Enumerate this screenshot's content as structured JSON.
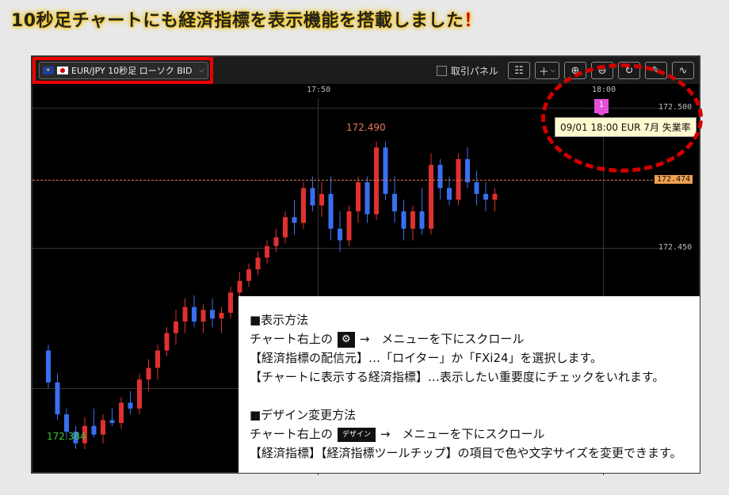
{
  "headline": {
    "text": "10秒足チャートにも経済指標を表示機能を搭載しました",
    "bang": "！"
  },
  "toolbar": {
    "symbol_label": "EUR/JPY 10秒足 ローソク BID",
    "panel_label": "取引パネル",
    "buttons": [
      "indicator-icon",
      "plus-icon",
      "zoom-in-icon",
      "zoom-out-icon",
      "refresh-icon",
      "pen-icon",
      "draw-icon"
    ]
  },
  "chart": {
    "time_labels": [
      "17:50",
      "18:00"
    ],
    "price_labels": [
      "172.500",
      "172.450"
    ],
    "current_price": "172.474",
    "high_label": "172.490",
    "low_label": "172.384",
    "event_marker": "1",
    "event_tooltip": "09/01 18:00 EUR 7月 失業率",
    "colors": {
      "up": "#e03030",
      "down": "#3a6ef0",
      "current": "#f0a050"
    }
  },
  "chart_data": {
    "type": "candlestick",
    "title": "",
    "xlabel": "",
    "ylabel": "",
    "ylim": [
      172.375,
      172.505
    ],
    "candles": [
      {
        "o": 172.418,
        "h": 172.42,
        "l": 172.405,
        "c": 172.407
      },
      {
        "o": 172.407,
        "h": 172.41,
        "l": 172.394,
        "c": 172.396
      },
      {
        "o": 172.396,
        "h": 172.398,
        "l": 172.388,
        "c": 172.39
      },
      {
        "o": 172.39,
        "h": 172.392,
        "l": 172.384,
        "c": 172.386
      },
      {
        "o": 172.386,
        "h": 172.395,
        "l": 172.384,
        "c": 172.392
      },
      {
        "o": 172.392,
        "h": 172.398,
        "l": 172.388,
        "c": 172.389
      },
      {
        "o": 172.389,
        "h": 172.396,
        "l": 172.386,
        "c": 172.394
      },
      {
        "o": 172.394,
        "h": 172.398,
        "l": 172.392,
        "c": 172.393
      },
      {
        "o": 172.393,
        "h": 172.402,
        "l": 172.391,
        "c": 172.4
      },
      {
        "o": 172.4,
        "h": 172.404,
        "l": 172.396,
        "c": 172.398
      },
      {
        "o": 172.398,
        "h": 172.41,
        "l": 172.396,
        "c": 172.408
      },
      {
        "o": 172.408,
        "h": 172.415,
        "l": 172.404,
        "c": 172.412
      },
      {
        "o": 172.412,
        "h": 172.42,
        "l": 172.408,
        "c": 172.418
      },
      {
        "o": 172.418,
        "h": 172.426,
        "l": 172.416,
        "c": 172.424
      },
      {
        "o": 172.424,
        "h": 172.432,
        "l": 172.42,
        "c": 172.428
      },
      {
        "o": 172.428,
        "h": 172.436,
        "l": 172.424,
        "c": 172.433
      },
      {
        "o": 172.433,
        "h": 172.437,
        "l": 172.426,
        "c": 172.428
      },
      {
        "o": 172.428,
        "h": 172.434,
        "l": 172.424,
        "c": 172.432
      },
      {
        "o": 172.432,
        "h": 172.436,
        "l": 172.426,
        "c": 172.429
      },
      {
        "o": 172.429,
        "h": 172.433,
        "l": 172.424,
        "c": 172.431
      },
      {
        "o": 172.431,
        "h": 172.44,
        "l": 172.429,
        "c": 172.438
      },
      {
        "o": 172.438,
        "h": 172.445,
        "l": 172.436,
        "c": 172.442
      },
      {
        "o": 172.442,
        "h": 172.448,
        "l": 172.44,
        "c": 172.446
      },
      {
        "o": 172.446,
        "h": 172.452,
        "l": 172.444,
        "c": 172.45
      },
      {
        "o": 172.45,
        "h": 172.456,
        "l": 172.448,
        "c": 172.454
      },
      {
        "o": 172.454,
        "h": 172.46,
        "l": 172.452,
        "c": 172.457
      },
      {
        "o": 172.457,
        "h": 172.466,
        "l": 172.455,
        "c": 172.464
      },
      {
        "o": 172.464,
        "h": 172.47,
        "l": 172.458,
        "c": 172.462
      },
      {
        "o": 172.462,
        "h": 172.476,
        "l": 172.46,
        "c": 172.474
      },
      {
        "o": 172.474,
        "h": 172.478,
        "l": 172.466,
        "c": 172.468
      },
      {
        "o": 172.468,
        "h": 172.476,
        "l": 172.464,
        "c": 172.472
      },
      {
        "o": 172.472,
        "h": 172.478,
        "l": 172.456,
        "c": 172.46
      },
      {
        "o": 172.46,
        "h": 172.466,
        "l": 172.452,
        "c": 172.456
      },
      {
        "o": 172.456,
        "h": 172.468,
        "l": 172.454,
        "c": 172.466
      },
      {
        "o": 172.466,
        "h": 172.478,
        "l": 172.462,
        "c": 172.476
      },
      {
        "o": 172.476,
        "h": 172.478,
        "l": 172.462,
        "c": 172.465
      },
      {
        "o": 172.465,
        "h": 172.49,
        "l": 172.463,
        "c": 172.488
      },
      {
        "o": 172.488,
        "h": 172.49,
        "l": 172.47,
        "c": 172.472
      },
      {
        "o": 172.472,
        "h": 172.478,
        "l": 172.462,
        "c": 172.466
      },
      {
        "o": 172.466,
        "h": 172.47,
        "l": 172.456,
        "c": 172.46
      },
      {
        "o": 172.46,
        "h": 172.468,
        "l": 172.456,
        "c": 172.466
      },
      {
        "o": 172.466,
        "h": 172.474,
        "l": 172.458,
        "c": 172.46
      },
      {
        "o": 172.46,
        "h": 172.486,
        "l": 172.458,
        "c": 172.482
      },
      {
        "o": 172.482,
        "h": 172.484,
        "l": 172.47,
        "c": 172.474
      },
      {
        "o": 172.474,
        "h": 172.478,
        "l": 172.468,
        "c": 172.47
      },
      {
        "o": 172.47,
        "h": 172.486,
        "l": 172.468,
        "c": 172.484
      },
      {
        "o": 172.484,
        "h": 172.488,
        "l": 172.474,
        "c": 172.476
      },
      {
        "o": 172.476,
        "h": 172.48,
        "l": 172.468,
        "c": 172.472
      },
      {
        "o": 172.472,
        "h": 172.476,
        "l": 172.466,
        "c": 172.47
      },
      {
        "o": 172.47,
        "h": 172.474,
        "l": 172.466,
        "c": 172.472
      }
    ]
  },
  "info": {
    "section1_title": "■表示方法",
    "s1_line1_a": "チャート右上の",
    "s1_line1_b": "→　メニューを下にスクロール",
    "s1_line2": "【経済指標の配信元】…「ロイター」か「FXi24」を選択します。",
    "s1_line3": "【チャートに表示する経済指標】…表示したい重要度にチェックをいれます。",
    "section2_title": "■デザイン変更方法",
    "s2_line1_a": "チャート右上の",
    "s2_design_chip": "デザイン",
    "s2_line1_b": "→　メニューを下にスクロール",
    "s2_line2": "【経済指標】【経済指標ツールチップ】の項目で色や文字サイズを変更できます。"
  }
}
